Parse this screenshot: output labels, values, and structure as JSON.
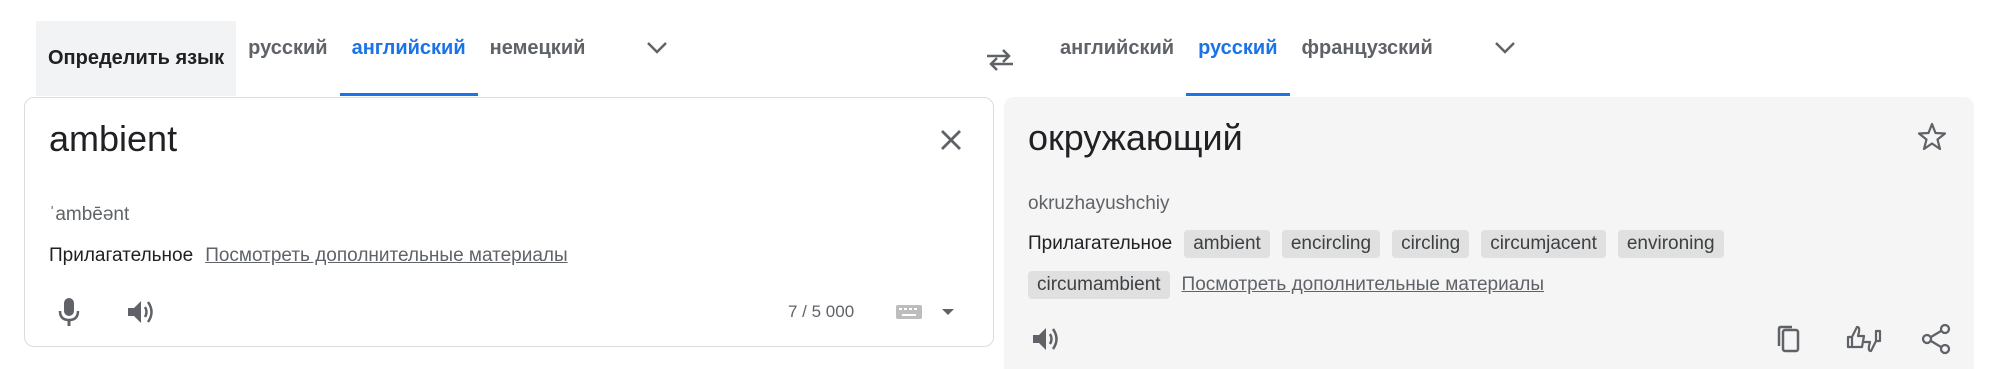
{
  "source_langs": {
    "detect": "Определить язык",
    "tabs": [
      "русский",
      "английский",
      "немецкий"
    ],
    "active": "английский"
  },
  "target_langs": {
    "tabs": [
      "английский",
      "русский",
      "французский"
    ],
    "active": "русский"
  },
  "source": {
    "text": "ambient",
    "transliteration": "ˈambēənt",
    "part_of_speech": "Прилагательное",
    "more_link": "Посмотреть дополнительные материалы",
    "char_count": "7 / 5 000"
  },
  "target": {
    "text": "окружающий",
    "transliteration": "okruzhayushchiy",
    "part_of_speech": "Прилагательное",
    "alternatives": [
      "ambient",
      "encircling",
      "circling",
      "circumjacent",
      "environing",
      "circumambient"
    ],
    "more_link": "Посмотреть дополнительные материалы"
  },
  "icons": {
    "chevron": "chevron-down-icon",
    "swap": "swap-icon",
    "close": "close-icon",
    "mic": "mic-icon",
    "speaker": "speaker-icon",
    "keyboard": "keyboard-icon",
    "star": "star-icon",
    "copy": "copy-icon",
    "feedback": "thumbs-icon",
    "share": "share-icon"
  },
  "colors": {
    "accent": "#1a73e8",
    "icon": "#5f6368",
    "panel_bg": "#f5f5f5",
    "chip_bg": "#e0e0e0"
  }
}
